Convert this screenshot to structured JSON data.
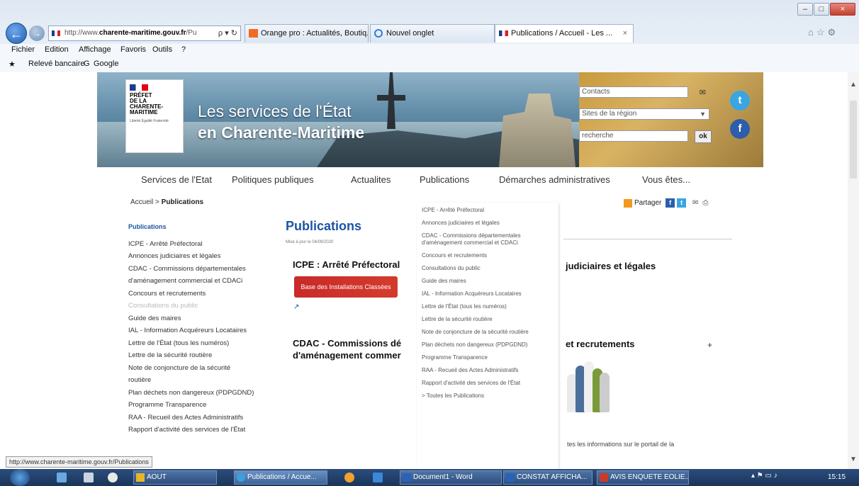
{
  "browser": {
    "address": {
      "prefix": "http://www.",
      "host": "charente-maritime.gouv.fr",
      "suffix": "/Pu",
      "icons": "ρ ▾ ↻"
    },
    "tabs": [
      {
        "label": "Orange pro : Actualités, Boutiq..."
      },
      {
        "label": "Nouvel onglet"
      },
      {
        "label": "Publications / Accueil - Les ..."
      }
    ],
    "tab_close": "×",
    "menu": [
      "Fichier",
      "Edition",
      "Affichage",
      "Favoris",
      "Outils",
      "?"
    ],
    "favorites": [
      "Relevé bancaire",
      "Google"
    ],
    "window_controls": {
      "min": "–",
      "max": "□",
      "close": "×"
    }
  },
  "banner": {
    "logo_lines": [
      "PRÉFET",
      "DE LA",
      "CHARENTE-",
      "MARITIME"
    ],
    "logo_motto": "Liberté Égalité Fraternité",
    "title_line1": "Les services de l'État",
    "title_line2": "en Charente-Maritime",
    "contact_placeholder": "Contacts",
    "region_select": "Sites de la région",
    "search_placeholder": "recherche",
    "search_button": "ok",
    "twitter": "t",
    "facebook": "f"
  },
  "nav": [
    "Services de l'Etat",
    "Politiques publiques",
    "Actualites",
    "Publications",
    "Démarches administratives",
    "Vous êtes..."
  ],
  "breadcrumb": {
    "home": "Accueil",
    "sep": " > ",
    "current": "Publications"
  },
  "share": {
    "label": "Partager",
    "fb": "f",
    "tw": "t",
    "mail": "✉",
    "print": "⎙"
  },
  "leftnav": {
    "heading": "Publications",
    "items": [
      "ICPE - Arrêté Préfectoral",
      "Annonces judiciaires et légales",
      "CDAC - Commissions départementales",
      "d'aménagement commercial et CDACi",
      "Concours et recrutements",
      "Consultations du public",
      "Guide des maires",
      "IAL - Information Acquéreurs Locataires",
      "Lettre de l'État (tous les numéros)",
      "Lettre de la sécurité routière",
      "Note de conjoncture de la sécurité",
      "routière",
      "Plan déchets non dangereux (PDPGDND)",
      "Programme Transparence",
      "RAA - Recueil des Actes Administratifs",
      "Rapport d'activité des services de l'État"
    ]
  },
  "main": {
    "title": "Publications",
    "updated": "Mise à jour le 04/09/2020",
    "icpe_title": "ICPE : Arrêté Préfectoral",
    "icpe_banner": "Base des Installations Classées",
    "ext_link": "↗",
    "cdac_title_1": "CDAC - Commissions dé",
    "cdac_title_2": "d'aménagement commer",
    "annonces_title": "judiciaires et légales",
    "concours_title": "et recrutements",
    "concours_plus": "+",
    "portal_text": "tes les informations sur le portail de la"
  },
  "dropdown": [
    "ICPE - Arrêté Préfectoral",
    "Annonces judiciaires et légales",
    "CDAC - Commissions départementales d'aménagement commercial et CDACi",
    "Concours et recrutements",
    "Consultations du public",
    "Guide des maires",
    "IAL - Information Acquéreurs Locataires",
    "Lettre de l'État (tous les numéros)",
    "Lettre de la sécurité routière",
    "Note de conjoncture de la sécurité routière",
    "Plan déchets non dangereux (PDPGDND)",
    "Programme Transparence",
    "RAA - Recueil des Actes Administratifs",
    "Rapport d'activité des services de l'État",
    "> Toutes les Publications"
  ],
  "statusbar": "http://www.charente-maritime.gouv.fr/Publications",
  "taskbar": {
    "items": [
      "AOUT",
      "Publications / Accue...",
      "Document1 - Word",
      "CONSTAT AFFICHA...",
      "AVIS ENQUETE EOLIE..."
    ],
    "tray": "▴ ⚑ ▭ ♪",
    "clock": "15:15"
  }
}
